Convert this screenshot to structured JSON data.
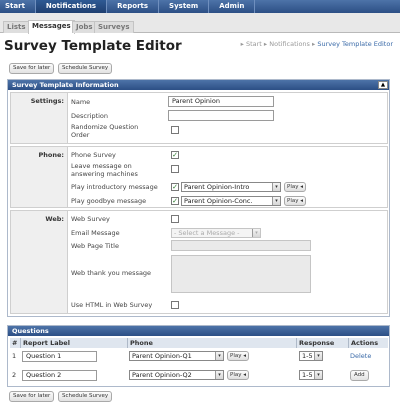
{
  "topnav": [
    "Start",
    "Notifications",
    "Reports",
    "System",
    "Admin"
  ],
  "subnav": [
    "Lists",
    "Messages",
    "Jobs",
    "Surveys"
  ],
  "page_title": "Survey Template Editor",
  "breadcrumb": {
    "start": "Start",
    "notifications": "Notifications",
    "current": "Survey Template Editor",
    "sep": "▸"
  },
  "buttons": {
    "save_later": "Save for later",
    "schedule": "Schedule Survey"
  },
  "info_panel": {
    "title": "Survey Template Information",
    "collapse_icon": "▲",
    "settings": {
      "label": "Settings:",
      "name_label": "Name",
      "name_value": "Parent Opinion",
      "description_label": "Description",
      "description_value": "",
      "randomize_label": "Randomize Question Order"
    },
    "phone": {
      "label": "Phone:",
      "phone_survey_label": "Phone Survey",
      "leave_message_label": "Leave message on answering machines",
      "intro_label": "Play introductory message",
      "intro_value": "Parent Opinion-Intro",
      "goodbye_label": "Play goodbye message",
      "goodbye_value": "Parent Opinion-Conc.",
      "play_label": "Play ◂"
    },
    "web": {
      "label": "Web:",
      "web_survey_label": "Web Survey",
      "email_label": "Email Message",
      "email_placeholder": "- Select a Message -",
      "page_title_label": "Web Page Title",
      "thank_you_label": "Web thank you message",
      "html_label": "Use HTML in Web Survey"
    }
  },
  "questions": {
    "title": "Questions",
    "columns": [
      "#",
      "Report Label",
      "Phone",
      "Response",
      "Actions"
    ],
    "rows": [
      {
        "num": "1",
        "label": "Question 1",
        "phone": "Parent Opinion-Q1",
        "response": "1-5",
        "action": "Delete"
      },
      {
        "num": "2",
        "label": "Question 2",
        "phone": "Parent Opinion-Q2",
        "response": "1-5",
        "action": "Add"
      }
    ],
    "play_label": "Play ◂"
  },
  "icons": {
    "check": "✓",
    "dropdown": "▾"
  }
}
